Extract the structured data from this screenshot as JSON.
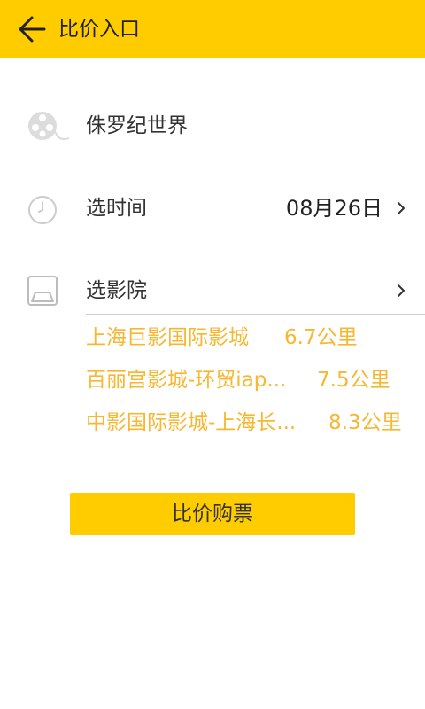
{
  "header": {
    "title": "比价入口",
    "back_icon": "back-arrow-icon"
  },
  "movie": {
    "name": "侏罗纪世界",
    "icon": "film-reel-icon"
  },
  "time": {
    "label": "选时间",
    "value": "08月26日",
    "icon": "clock-icon"
  },
  "cinema": {
    "label": "选影院",
    "icon": "cinema-screen-icon",
    "items": [
      {
        "name": "上海巨影国际影城",
        "distance": "6.7公里"
      },
      {
        "name": "百丽宫影城-环贸iap...",
        "distance": "7.5公里"
      },
      {
        "name": "中影国际影城-上海长...",
        "distance": "8.3公里"
      }
    ]
  },
  "action": {
    "buy_label": "比价购票"
  },
  "colors": {
    "accent": "#FFCC00",
    "link": "#F7B731"
  }
}
